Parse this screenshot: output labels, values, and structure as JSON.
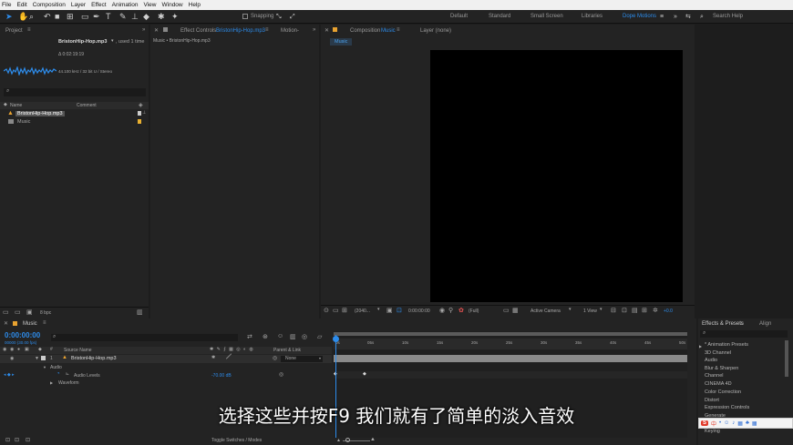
{
  "menu": [
    "File",
    "Edit",
    "Composition",
    "Layer",
    "Effect",
    "Animation",
    "View",
    "Window",
    "Help"
  ],
  "toolbar": {
    "snapping": "Snapping",
    "workspaces": [
      "Default",
      "Standard",
      "Small Screen",
      "Libraries"
    ],
    "active_workspace": "Dope Motions",
    "search_placeholder": "Search Help"
  },
  "project": {
    "title": "Project",
    "item_name": "BristonHip-Hop.mp3",
    "used": ", used 1 time",
    "duration": "Δ 0:02:19:19",
    "audio_info": "44.100 kHz / 32 bit U / Stereo",
    "col_name": "Name",
    "col_comment": "Comment",
    "items": [
      "BristonHip-Hop.mp3",
      "Music"
    ],
    "bpc": "8 bpc"
  },
  "effect_controls": {
    "label": "Effect Controls",
    "file": "BristonHip-Hop.mp3",
    "other_tab": "Motion-",
    "breadcrumb": "Music • BristonHip-Hop.mp3"
  },
  "composition": {
    "label": "Composition",
    "name": "Music",
    "layer_tab": "Layer  (none)",
    "subtab": "Music",
    "zoom": "(2040...",
    "timecode": "0:00:00:00",
    "quality": "(Full)",
    "camera": "Active Camera",
    "views": "1 View",
    "exposure": "+0.0"
  },
  "timeline": {
    "comp_tab": "Music",
    "timecode": "0:00:00:00",
    "frame_info": "00000 (30.00 fps)",
    "col_source": "Source Name",
    "col_parent": "Parent & Link",
    "layer_num": "1",
    "layer_name": "BristonHip-Hop.mp3",
    "parent_value": "None",
    "audio": "Audio",
    "audio_levels": "Audio Levels",
    "audio_value": "-70.00 dB",
    "waveform": "Waveform",
    "ruler": [
      "0s",
      "05s",
      "10s",
      "15s",
      "20s",
      "25s",
      "30s",
      "35s",
      "40s",
      "45s",
      "50s"
    ],
    "toggle": "Toggle Switches / Modes"
  },
  "effects_presets": {
    "title": "Effects & Presets",
    "align_tab": "Align",
    "items": [
      "* Animation Presets",
      "3D Channel",
      "Audio",
      "Blur & Sharpen",
      "Channel",
      "CINEMA 4D",
      "Color Correction",
      "Distort",
      "Expression Controls",
      "Generate",
      "Keying"
    ]
  },
  "subtitle": "选择这些并按F9 我们就有了简单的淡入音效",
  "ime": {
    "label": "中"
  }
}
